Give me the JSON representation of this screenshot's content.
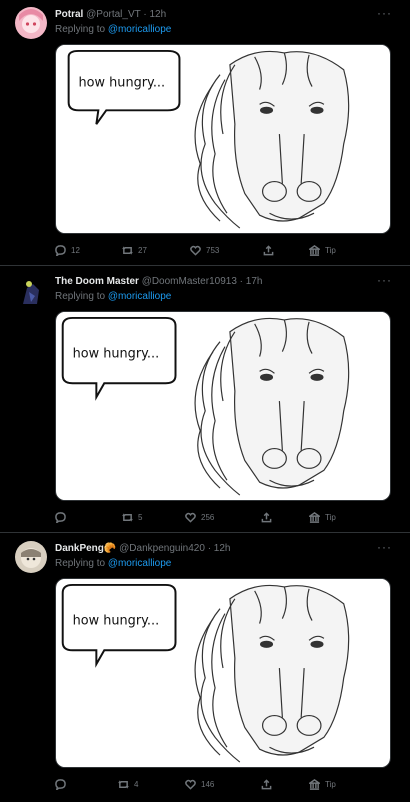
{
  "tweets": [
    {
      "name": "Potral",
      "handle": "@Portal_VT",
      "time": "· 12h",
      "replying_label": "Replying to",
      "mention": "@moricalliope",
      "bubble_text": "how hungry...",
      "replies": "12",
      "retweets": "27",
      "likes": "753",
      "tip": "Tip",
      "avatar_color": "#f3b7c6"
    },
    {
      "name": "The Doom Master",
      "handle": "@DoomMaster10913",
      "time": "· 17h",
      "replying_label": "Replying to",
      "mention": "@moricalliope",
      "bubble_text": "how hungry...",
      "replies": "",
      "retweets": "5",
      "likes": "256",
      "tip": "Tip",
      "avatar_color": "#1b1e3a"
    },
    {
      "name": "DankPeng🥐",
      "handle": "@Dankpenguin420",
      "time": "· 12h",
      "replying_label": "Replying to",
      "mention": "@moricalliope",
      "bubble_text": "how hungry...",
      "replies": "",
      "retweets": "4",
      "likes": "146",
      "tip": "Tip",
      "avatar_color": "#d8cfc0"
    }
  ],
  "colors": {
    "background": "#000000",
    "text": "#e7e9ea",
    "muted": "#71767b",
    "link": "#1d9bf0",
    "divider": "#2f3336"
  },
  "icons": [
    "more-icon",
    "reply-icon",
    "retweet-icon",
    "like-icon",
    "share-icon",
    "tip-icon"
  ]
}
